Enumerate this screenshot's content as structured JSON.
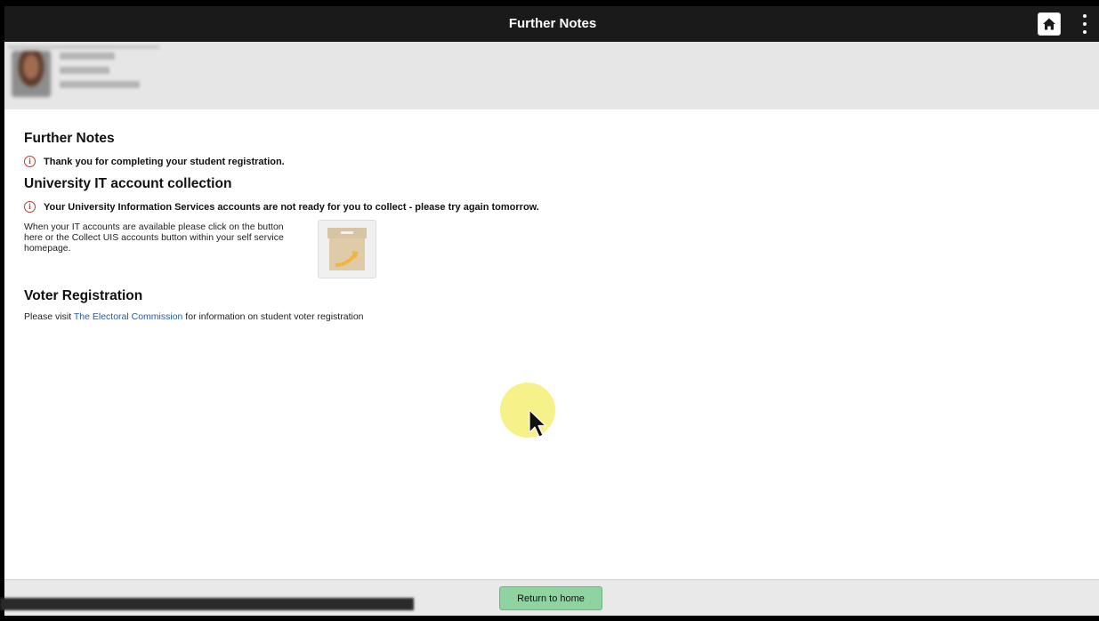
{
  "header": {
    "title": "Further Notes",
    "home_icon": "home-icon",
    "menu_icon": "kebab-menu-icon"
  },
  "profile": {
    "avatar_icon": "user-avatar"
  },
  "sections": {
    "further_notes": {
      "heading": "Further Notes",
      "message": "Thank you for completing your student registration."
    },
    "it_accounts": {
      "heading": "University IT account collection",
      "message": "Your University Information Services accounts are not ready for you to collect - please try again tomorrow.",
      "instructions": "When your IT accounts are available please click on the button here or the Collect UIS accounts button within your self service homepage.",
      "collect_icon": "box-collect-icon"
    },
    "voter": {
      "heading": "Voter Registration",
      "text_before": "Please visit ",
      "link_text": "The Electoral Commission",
      "text_after": " for information on student voter registration"
    }
  },
  "footer": {
    "return_label": "Return to home"
  },
  "colors": {
    "topbar": "#1a1a1a",
    "profile_band": "#e6e6e6",
    "return_button": "#8ed3a0",
    "link": "#2b5aa3",
    "info_icon": "#c0392b"
  }
}
